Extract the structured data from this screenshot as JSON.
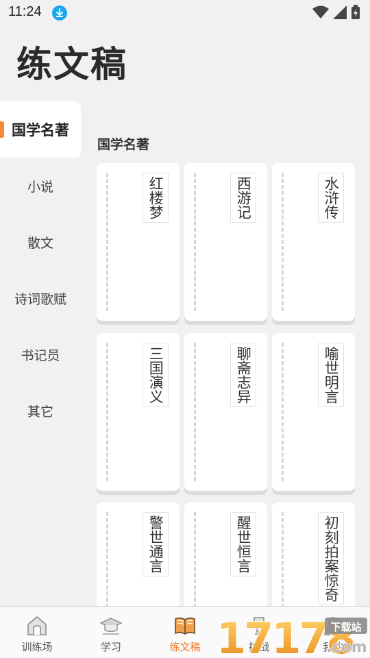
{
  "status_bar": {
    "time": "11:24"
  },
  "page": {
    "title": "练文稿"
  },
  "sidebar": {
    "items": [
      {
        "label": "国学名著",
        "active": true
      },
      {
        "label": "小说"
      },
      {
        "label": "散文"
      },
      {
        "label": "诗词歌赋"
      },
      {
        "label": "书记员"
      },
      {
        "label": "其它"
      }
    ]
  },
  "section": {
    "title": "国学名著"
  },
  "books": [
    "红楼梦",
    "西游记",
    "水浒传",
    "三国演义",
    "聊斋志异",
    "喻世明言",
    "警世通言",
    "醒世恒言",
    "初刻拍案惊奇"
  ],
  "bottom_nav": {
    "items": [
      {
        "label": "训练场",
        "icon": "home-icon"
      },
      {
        "label": "学习",
        "icon": "graduation-cap-icon"
      },
      {
        "label": "练文稿",
        "icon": "book-icon",
        "active": true
      },
      {
        "label": "挑战",
        "icon": "trophy-icon"
      },
      {
        "label": "我的",
        "icon": "user-icon"
      }
    ]
  },
  "watermark": {
    "text": "17178",
    "suffix": "下载站",
    "domain": ".com"
  },
  "colors": {
    "accent": "#f07a2a",
    "marker": "#f28a3c",
    "download_badge": "#1aa7ec"
  }
}
